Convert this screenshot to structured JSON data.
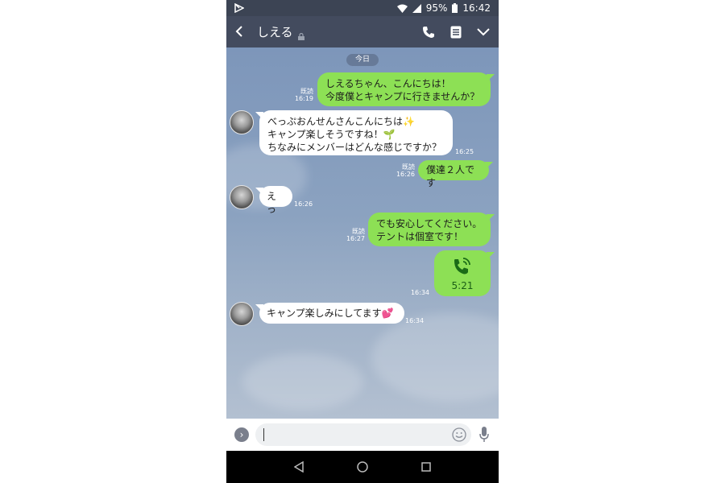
{
  "status_bar": {
    "battery": "95%",
    "time": "16:42"
  },
  "header": {
    "contact_name": "しえる"
  },
  "chat": {
    "date_label": "今日",
    "messages": [
      {
        "from": "me",
        "lines": [
          "しえるちゃん、こんにちは！",
          "今度僕とキャンプに行きませんか？"
        ],
        "read": "既読",
        "time": "16:19"
      },
      {
        "from": "them",
        "lines": [
          "べっぷおんせんさんこんにちは✨",
          "キャンプ楽しそうですね！🌱",
          "ちなみにメンバーはどんな感じですか？"
        ],
        "time": "16:25"
      },
      {
        "from": "me",
        "lines": [
          "僕達２人です"
        ],
        "read": "既読",
        "time": "16:26"
      },
      {
        "from": "them",
        "lines": [
          "えっ"
        ],
        "time": "16:26"
      },
      {
        "from": "me",
        "lines": [
          "でも安心してください。",
          "テントは個室です！"
        ],
        "read": "既読",
        "time": "16:27"
      },
      {
        "from": "me",
        "type": "call",
        "duration": "5:21",
        "time": "16:34"
      },
      {
        "from": "them",
        "lines": [
          "キャンプ楽しみにしてます💕"
        ],
        "time": "16:34"
      }
    ]
  },
  "input": {
    "value": "",
    "placeholder": ""
  },
  "icons": {
    "back": "chevron-left-icon",
    "lock": "lock-icon",
    "call": "phone-icon",
    "notes": "notes-icon",
    "menu": "chevron-down-icon",
    "expand": "chevron-right-icon",
    "emoji": "emoji-icon",
    "mic": "mic-icon",
    "nav_back": "triangle-back-icon",
    "nav_home": "circle-home-icon",
    "nav_recents": "square-recents-icon"
  },
  "colors": {
    "my_bubble": "#8de055",
    "their_bubble": "#ffffff",
    "header": "#434b5e",
    "chat_bg": "#7d96ba"
  }
}
